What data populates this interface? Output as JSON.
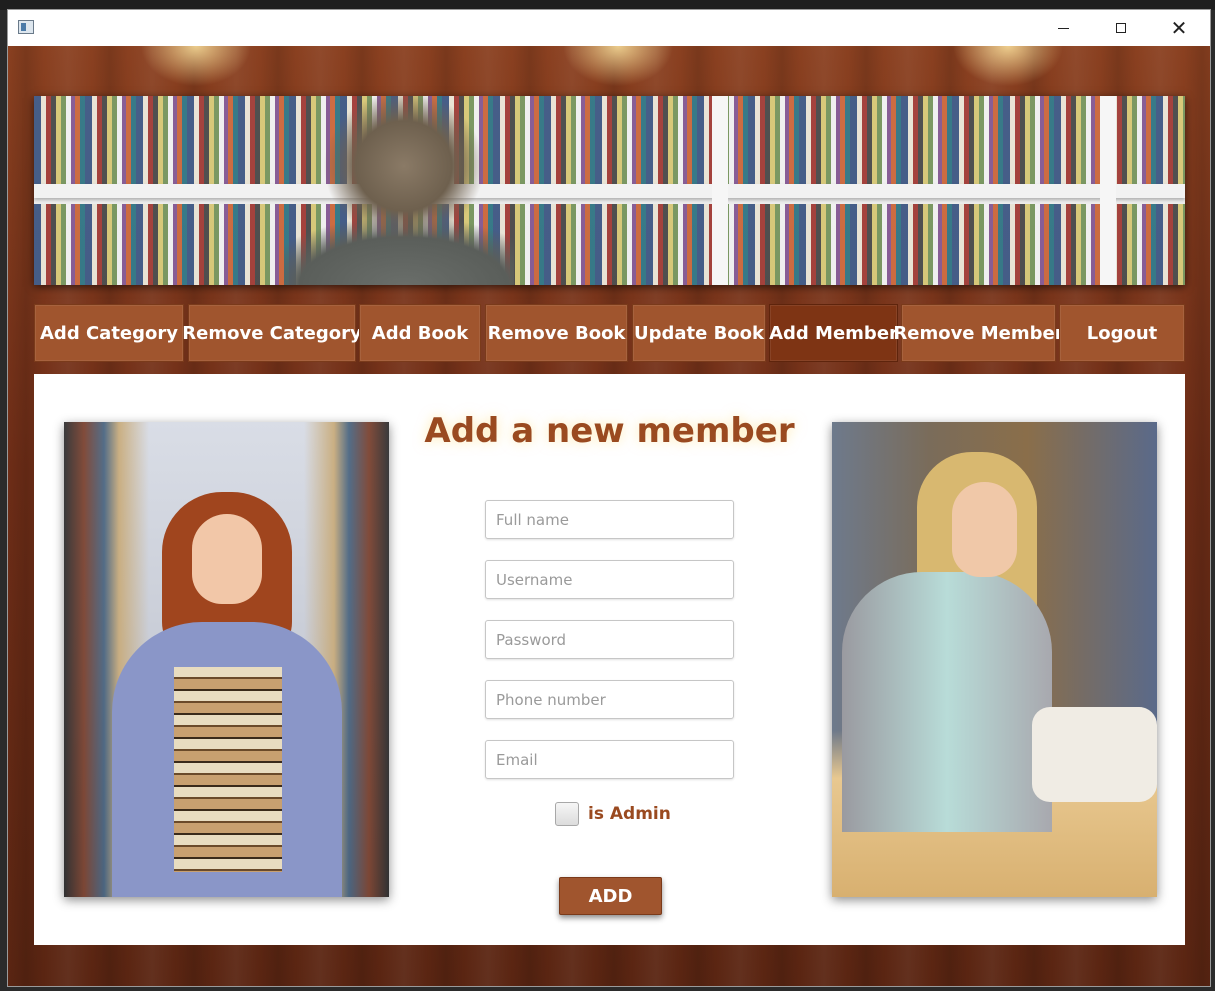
{
  "window": {
    "minimize_icon": "minimize-icon",
    "maximize_icon": "maximize-icon",
    "close_icon": "close-icon",
    "close_glyph": "✕"
  },
  "colors": {
    "accent": "#a0552e",
    "accent_active": "#7e3414",
    "title_text": "#9a4a20"
  },
  "nav": {
    "items": [
      {
        "label": "Add Category",
        "active": false
      },
      {
        "label": "Remove Category",
        "active": false
      },
      {
        "label": "Add Book",
        "active": false
      },
      {
        "label": "Remove Book",
        "active": false
      },
      {
        "label": "Update Book",
        "active": false
      },
      {
        "label": "Add Member",
        "active": true
      },
      {
        "label": "Remove Member",
        "active": false
      },
      {
        "label": "Logout",
        "active": false
      }
    ]
  },
  "form": {
    "title": "Add a new member",
    "fields": {
      "full_name": {
        "placeholder": "Full name",
        "value": ""
      },
      "username": {
        "placeholder": "Username",
        "value": ""
      },
      "password": {
        "placeholder": "Password",
        "value": ""
      },
      "phone": {
        "placeholder": "Phone number",
        "value": ""
      },
      "email": {
        "placeholder": "Email",
        "value": ""
      }
    },
    "is_admin_label": "is Admin",
    "is_admin_checked": false,
    "submit_label": "ADD"
  }
}
